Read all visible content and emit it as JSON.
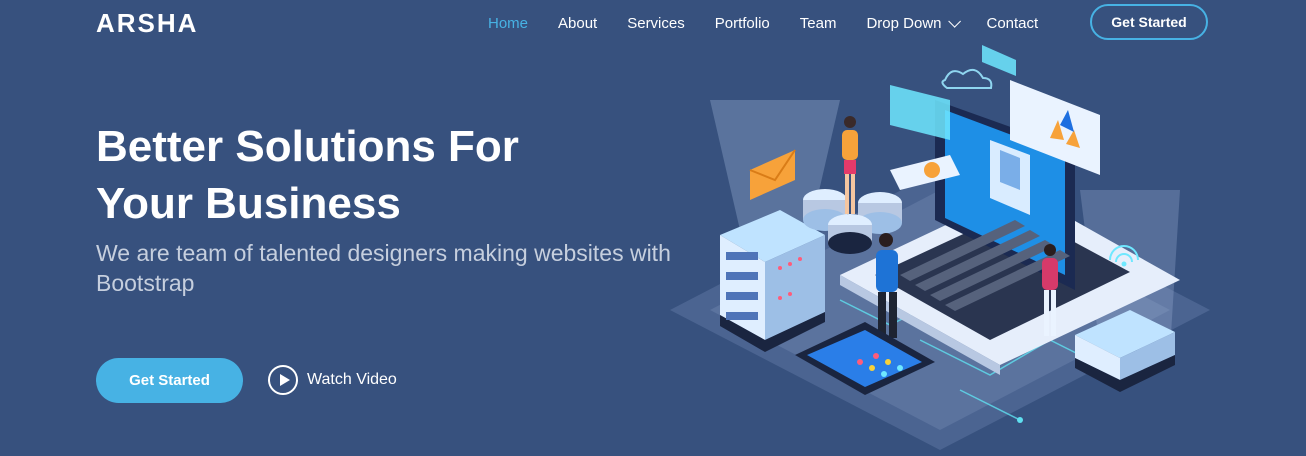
{
  "brand": "ARSHA",
  "nav": {
    "items": [
      "Home",
      "About",
      "Services",
      "Portfolio",
      "Team",
      "Drop Down",
      "Contact"
    ],
    "cta": "Get Started"
  },
  "hero": {
    "title_line1": "Better Solutions For",
    "title_line2": "Your Business",
    "subtitle": "We are team of talented designers making websites with Bootstrap",
    "primary_button": "Get Started",
    "video_link": "Watch Video"
  },
  "colors": {
    "background": "#37517e",
    "accent": "#47b2e4",
    "subtitle": "#c6cfde"
  },
  "icons": {
    "dropdown": "chevron-down-icon",
    "video": "play-circle-icon"
  }
}
